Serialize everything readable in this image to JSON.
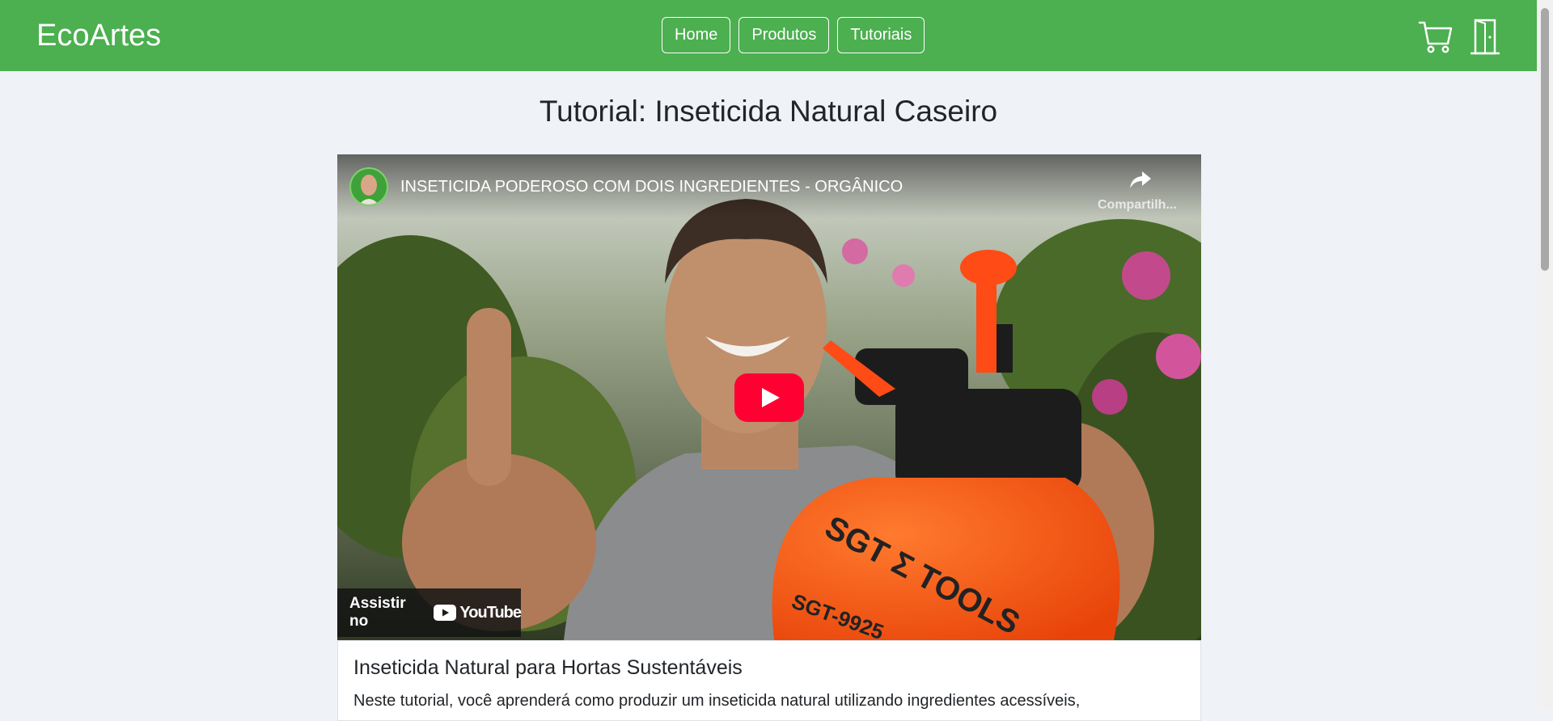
{
  "brand": "EcoArtes",
  "nav": {
    "links": [
      "Home",
      "Produtos",
      "Tutoriais"
    ]
  },
  "icons": {
    "cart": "cart-icon",
    "logout": "door-icon"
  },
  "page": {
    "title": "Tutorial: Inseticida Natural Caseiro"
  },
  "video": {
    "title": "INSETICIDA PODEROSO COM DOIS INGREDIENTES - ORGÂNICO",
    "share_label": "Compartilh...",
    "watch_on": "Assistir no",
    "youtube": "YouTube",
    "bottle_text": "SGT Σ TOOLS",
    "bottle_model": "SGT-9925"
  },
  "card": {
    "title": "Inseticida Natural para Hortas Sustentáveis",
    "text": "Neste tutorial, você aprenderá como produzir um inseticida natural utilizando ingredientes acessíveis,"
  },
  "colors": {
    "navbar": "#4caf50",
    "background": "#eff2f7",
    "play": "#ff0033",
    "bottle": "#ff5a14"
  }
}
